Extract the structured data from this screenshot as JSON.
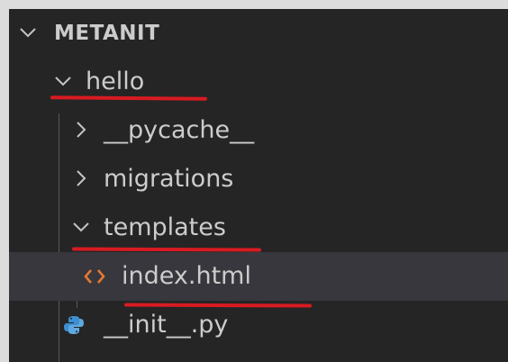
{
  "explorer": {
    "root": {
      "label": "METANIT",
      "expanded": true
    },
    "items": [
      {
        "label": "hello",
        "type": "folder",
        "expanded": true
      },
      {
        "label": "__pycache__",
        "type": "folder",
        "expanded": false
      },
      {
        "label": "migrations",
        "type": "folder",
        "expanded": false
      },
      {
        "label": "templates",
        "type": "folder",
        "expanded": true
      },
      {
        "label": "index.html",
        "type": "file",
        "icon": "html-file-icon",
        "selected": true
      },
      {
        "label": "__init__.py",
        "type": "file",
        "icon": "python-file-icon"
      }
    ]
  },
  "colors": {
    "background": "#252526",
    "selected_row": "#37373d",
    "text": "#cccccc",
    "annotation": "#d81b21",
    "html_icon": "#e37933",
    "python_icon": "#3d8fd1"
  }
}
